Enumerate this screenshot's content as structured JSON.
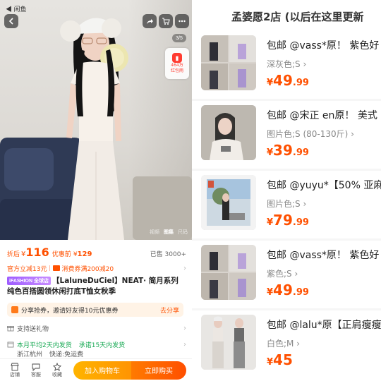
{
  "status_bar": {
    "back_app": "◀ 闲鱼"
  },
  "gallery": {
    "counter": "3/5",
    "redpack_line1": "464万",
    "redpack_line2": "红包雨",
    "tabs": [
      "视频",
      "图集",
      "尺码"
    ],
    "active_tab": "图集"
  },
  "price": {
    "discount_label": "折后",
    "discount_currency": "¥",
    "discount_value": "116",
    "coupon_label": "优惠前",
    "coupon_currency": "¥",
    "coupon_value": "129",
    "sold": "已售 3000+"
  },
  "promos": {
    "instant": "官方立减13元",
    "coupon": "消费券满200减20"
  },
  "product": {
    "badge": "iFASHION 全球店",
    "title": "【LaluneDuCiel】NEAT· 简月系列 纯色百搭圆领休闲打底T恤女秋季"
  },
  "share": {
    "text": "分享抢券，邀请好友得10元优惠券",
    "action": "去分享"
  },
  "service": {
    "gift": "支持送礼物"
  },
  "shipping": {
    "avg": "本月平均2天内发货",
    "promise": "承诺15天内发货",
    "location": "浙江杭州",
    "express_label": "快递:",
    "express_value": "免运费"
  },
  "bottom_bar": {
    "shop": "店铺",
    "service": "客服",
    "favorite": "收藏",
    "add_cart": "加入购物车",
    "buy_now": "立即购买"
  },
  "right": {
    "title": "孟婆愿2店 (以后在这里更新",
    "items": [
      {
        "name": "包邮 @vass*原！ 紫色好",
        "spec": "深灰色;S",
        "currency": "¥",
        "int": "49",
        "dec": ".99"
      },
      {
        "name": "包邮 @宋正 en原！ 美式",
        "spec": "图片色;S (80-130斤)",
        "currency": "¥",
        "int": "39",
        "dec": ".99"
      },
      {
        "name": "包邮 @yuyu*【50% 亚麻",
        "spec": "图片色;S",
        "currency": "¥",
        "int": "79",
        "dec": ".99"
      },
      {
        "name": "包邮 @vass*原！ 紫色好",
        "spec": "紫色;S",
        "currency": "¥",
        "int": "49",
        "dec": ".99"
      },
      {
        "name": "包邮 @lalu*原【正肩瘦瘦",
        "spec": "白色;M",
        "currency": "¥",
        "int": "45",
        "dec": ""
      }
    ]
  }
}
